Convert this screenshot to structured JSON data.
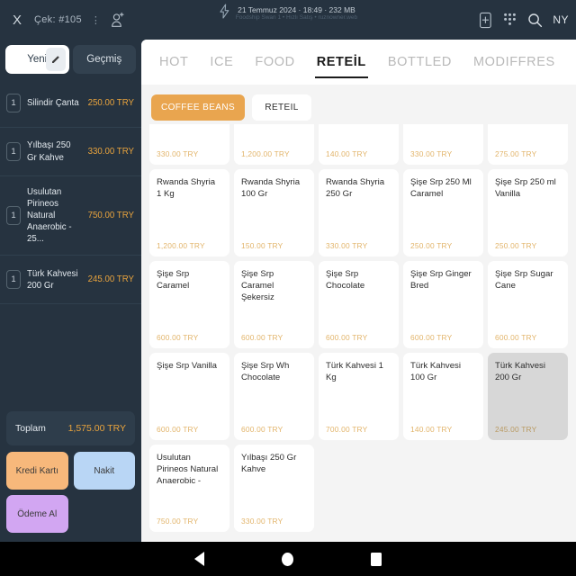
{
  "topbar": {
    "close_label": "X",
    "check_label": "Çek: #105",
    "menu_dots": "⋮",
    "add_person_icon": "add-person-icon",
    "datetime": "21 Temmuz 2024 · 18:49 · 232 MB",
    "subtitle": "Foodship Swan 1 • Hızlı Satış • ruznowner.web",
    "tablet_add_icon": "tablet-add-icon",
    "keypad_icon": "keypad-icon",
    "search_icon": "search-icon",
    "user_initials": "NY"
  },
  "order": {
    "tabs": [
      {
        "label": "Yeni",
        "active": true
      },
      {
        "label": "Geçmiş",
        "active": false
      }
    ],
    "pencil_icon": "pencil-icon",
    "items": [
      {
        "qty": "1",
        "name": "Silindir Çanta",
        "price": "250.00 TRY"
      },
      {
        "qty": "1",
        "name": "Yılbaşı 250 Gr Kahve",
        "price": "330.00 TRY"
      },
      {
        "qty": "1",
        "name": "Usulutan Pirineos Natural Anaerobic - 25...",
        "price": "750.00 TRY"
      },
      {
        "qty": "1",
        "name": "Türk Kahvesi 200 Gr",
        "price": "245.00 TRY"
      }
    ],
    "total_label": "Toplam",
    "total_value": "1,575.00 TRY",
    "buttons": [
      {
        "label": "Kredi Kartı",
        "color": "#f7b87b"
      },
      {
        "label": "Nakit",
        "color": "#b9d6f5"
      },
      {
        "label": "Ödeme Al",
        "color": "#d2a6f2"
      }
    ]
  },
  "catalog": {
    "tabs": [
      {
        "label": "HOT",
        "active": false
      },
      {
        "label": "ICE",
        "active": false
      },
      {
        "label": "FOOD",
        "active": false
      },
      {
        "label": "RETEİL",
        "active": true
      },
      {
        "label": "BOTTLED",
        "active": false
      },
      {
        "label": "MODIFFRES",
        "active": false
      }
    ],
    "subcategories": [
      {
        "label": "COFFEE BEANS",
        "active": true
      },
      {
        "label": "RETEIL",
        "active": false
      }
    ],
    "products": [
      {
        "name": "",
        "price": "330.00 TRY",
        "selected": false,
        "partial": true
      },
      {
        "name": "",
        "price": "1,200.00 TRY",
        "selected": false,
        "partial": true
      },
      {
        "name": "",
        "price": "140.00 TRY",
        "selected": false,
        "partial": true
      },
      {
        "name": "",
        "price": "330.00 TRY",
        "selected": false,
        "partial": true
      },
      {
        "name": "",
        "price": "275.00 TRY",
        "selected": false,
        "partial": true
      },
      {
        "name": "Rwanda Shyria 1 Kg",
        "price": "1,200.00 TRY",
        "selected": false
      },
      {
        "name": "Rwanda Shyria 100 Gr",
        "price": "150.00 TRY",
        "selected": false
      },
      {
        "name": "Rwanda Shyria 250 Gr",
        "price": "330.00 TRY",
        "selected": false
      },
      {
        "name": "Şişe Srp 250 Ml Caramel",
        "price": "250.00 TRY",
        "selected": false
      },
      {
        "name": "Şişe Srp 250 ml Vanilla",
        "price": "250.00 TRY",
        "selected": false
      },
      {
        "name": "Şişe Srp Caramel",
        "price": "600.00 TRY",
        "selected": false
      },
      {
        "name": "Şişe Srp Caramel Şekersiz",
        "price": "600.00 TRY",
        "selected": false
      },
      {
        "name": "Şişe Srp Chocolate",
        "price": "600.00 TRY",
        "selected": false
      },
      {
        "name": "Şişe Srp Ginger Bred",
        "price": "600.00 TRY",
        "selected": false
      },
      {
        "name": "Şişe Srp Sugar Cane",
        "price": "600.00 TRY",
        "selected": false
      },
      {
        "name": "Şişe Srp Vanilla",
        "price": "600.00 TRY",
        "selected": false
      },
      {
        "name": "Şişe Srp Wh Chocolate",
        "price": "600.00 TRY",
        "selected": false
      },
      {
        "name": "Türk Kahvesi 1 Kg",
        "price": "700.00 TRY",
        "selected": false
      },
      {
        "name": "Türk Kahvesi 100 Gr",
        "price": "140.00 TRY",
        "selected": false
      },
      {
        "name": "Türk Kahvesi 200 Gr",
        "price": "245.00 TRY",
        "selected": true
      },
      {
        "name": "Usulutan Pirineos Natural Anaerobic -",
        "price": "750.00 TRY",
        "selected": false
      },
      {
        "name": "Yılbaşı 250 Gr Kahve",
        "price": "330.00 TRY",
        "selected": false
      }
    ]
  },
  "navbar": {
    "back_icon": "back-triangle-icon",
    "home_icon": "home-circle-icon",
    "recent_icon": "recent-square-icon"
  }
}
